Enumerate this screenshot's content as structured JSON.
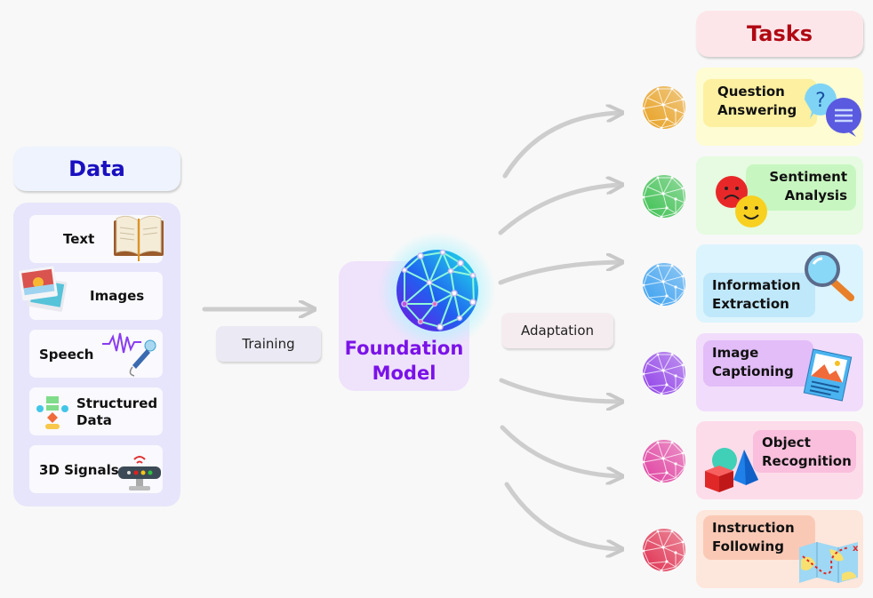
{
  "data_section": {
    "title": "Data",
    "items": [
      {
        "label": "Text",
        "icon": "book-icon"
      },
      {
        "label": "Images",
        "icon": "photos-icon"
      },
      {
        "label": "Speech",
        "icon": "microphone-icon"
      },
      {
        "label_line1": "Structured",
        "label_line2": "Data",
        "icon": "flowchart-icon"
      },
      {
        "label": "3D Signals",
        "icon": "router-icon"
      }
    ]
  },
  "training_label": "Training",
  "foundation_model": {
    "line1": "Foundation",
    "line2": "Model"
  },
  "adaptation_label": "Adaptation",
  "tasks_section": {
    "title": "Tasks",
    "items": [
      {
        "line1": "Question",
        "line2": "Answering",
        "icon": "chat-question-icon",
        "card_color": "#fefcd2",
        "label_color": "#fdf0a0",
        "globe_color": "#e8a020"
      },
      {
        "line1": "Sentiment",
        "line2": "Analysis",
        "icon": "emoji-faces-icon",
        "card_color": "#e6fbe1",
        "label_color": "#c8f6c0",
        "globe_color": "#3cc050"
      },
      {
        "line1": "Information",
        "line2": "Extraction",
        "icon": "magnifier-icon",
        "card_color": "#dcf4fd",
        "label_color": "#bfe8fb",
        "globe_color": "#3aa0f0"
      },
      {
        "line1": "Image",
        "line2": "Captioning",
        "icon": "picture-card-icon",
        "card_color": "#f1dcfb",
        "label_color": "#e2bdf8",
        "globe_color": "#9040e8"
      },
      {
        "line1": "Object",
        "line2": "Recognition",
        "icon": "shapes-icon",
        "card_color": "#fddcea",
        "label_color": "#f9bfdc",
        "globe_color": "#e040a0"
      },
      {
        "line1": "Instruction",
        "line2": "Following",
        "icon": "treasure-map-icon",
        "card_color": "#fde6dc",
        "label_color": "#fac9b5",
        "globe_color": "#e03050"
      }
    ]
  }
}
